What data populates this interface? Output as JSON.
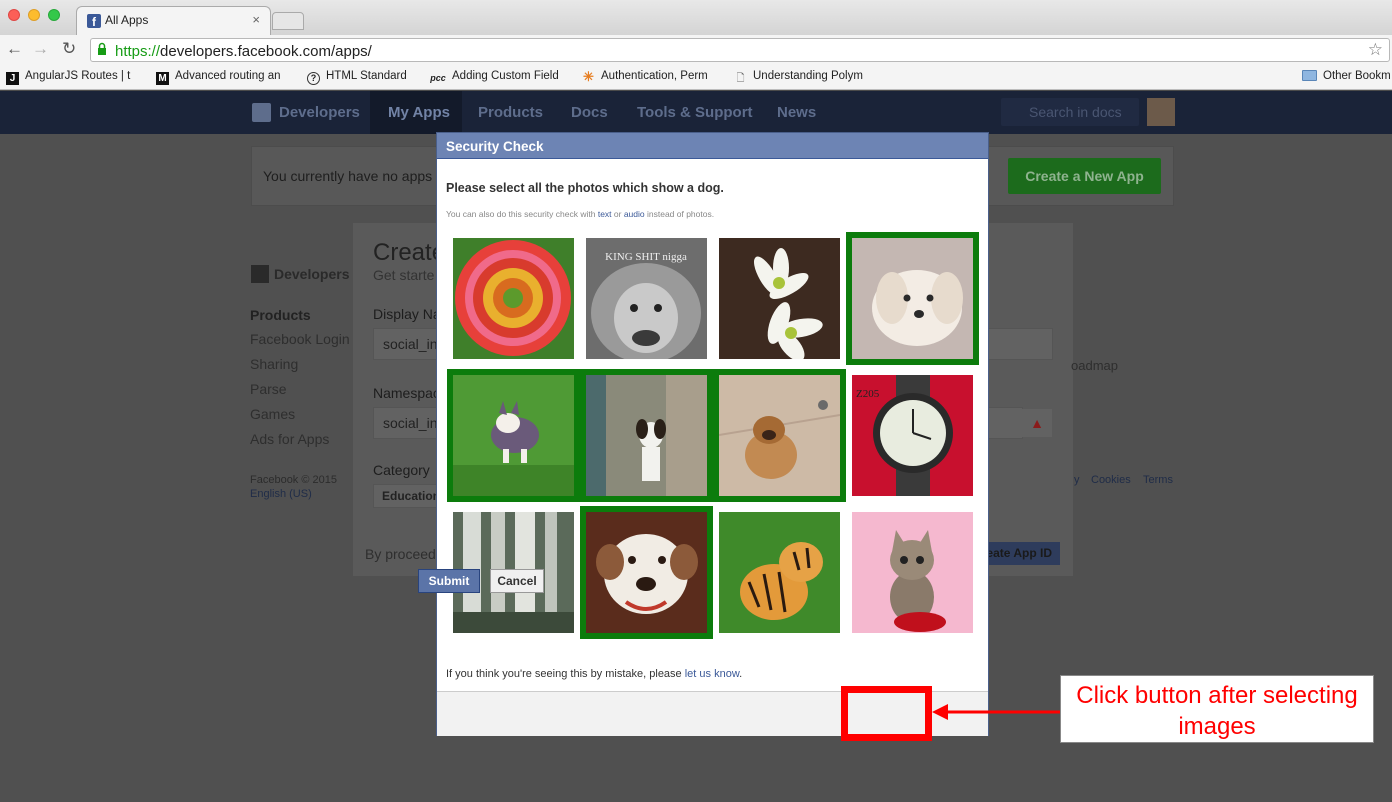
{
  "browser": {
    "tab_title": "All Apps",
    "tab_close": "×",
    "url_scheme": "https://",
    "url_rest": "developers.facebook.com/apps/",
    "bookmarks": [
      {
        "label": "AngularJS Routes | t",
        "icon": "J"
      },
      {
        "label": "Advanced routing an",
        "icon": "M"
      },
      {
        "label": "HTML Standard",
        "icon": "?"
      },
      {
        "label": "Adding Custom Field",
        "icon": "pcc"
      },
      {
        "label": "Authentication, Perm",
        "icon": "✳"
      },
      {
        "label": "Understanding Polym",
        "icon": "🗋"
      },
      {
        "label": "Other Bookm",
        "icon": "folder"
      }
    ]
  },
  "fb_nav": {
    "brand": "Developers",
    "items": [
      "My Apps",
      "Products",
      "Docs",
      "Tools & Support",
      "News"
    ],
    "search_placeholder": "Search in docs"
  },
  "background_page": {
    "no_apps_text": "You currently have no apps",
    "create_app_label": "Create a New App",
    "sidebar_brand": "Developers",
    "sidebar_heading": "Products",
    "sidebar_items": [
      "Facebook Login",
      "Sharing",
      "Parse",
      "Games",
      "Ads for Apps"
    ],
    "copyright": "Facebook © 2015",
    "language": "English (US)",
    "form_title": "Create",
    "form_subtitle": "Get starte",
    "display_name_label": "Display Na",
    "display_name_value": "social_in",
    "namespace_label": "Namespac",
    "namespace_value": "social_in",
    "category_label": "Category",
    "category_value": "Education",
    "footer_text": "By proceed",
    "create_id_label": "eate App ID",
    "right_link_roadmap": "oadmap",
    "right_link_y": "y",
    "right_link_cookies": "Cookies",
    "right_link_terms": "Terms",
    "warning_icon": "warning-icon"
  },
  "modal": {
    "title": "Security Check",
    "prompt": "Please select all the photos which show a dog.",
    "alt_prefix": "You can also do this security check with ",
    "alt_text_link": "text",
    "alt_or": " or ",
    "alt_audio_link": "audio",
    "alt_suffix": " instead of photos.",
    "mistake_prefix": "If you think you're seeing this by mistake, please ",
    "mistake_link": "let us know",
    "mistake_suffix": ".",
    "submit_label": "Submit",
    "cancel_label": "Cancel",
    "photos": [
      {
        "subject": "flower",
        "selected": false,
        "caption": ""
      },
      {
        "subject": "lion",
        "selected": false,
        "caption": "KING SHIT nigga"
      },
      {
        "subject": "flower",
        "selected": false,
        "caption": ""
      },
      {
        "subject": "dog",
        "selected": true,
        "caption": ""
      },
      {
        "subject": "dog",
        "selected": true,
        "caption": ""
      },
      {
        "subject": "dog",
        "selected": true,
        "caption": ""
      },
      {
        "subject": "dog",
        "selected": true,
        "caption": ""
      },
      {
        "subject": "watch",
        "selected": false,
        "caption": "Z205"
      },
      {
        "subject": "waterfall",
        "selected": false,
        "caption": ""
      },
      {
        "subject": "dog",
        "selected": true,
        "caption": ""
      },
      {
        "subject": "tiger",
        "selected": false,
        "caption": ""
      },
      {
        "subject": "kitten",
        "selected": false,
        "caption": ""
      }
    ]
  },
  "annotation": {
    "line1": "Click button after selecting",
    "line2": "images",
    "color": "#ff0000"
  },
  "colors": {
    "fb_blue": "#3b5998",
    "modal_header": "#6d84b4",
    "selected_border": "#0c7c0c",
    "create_button": "#1c6b1c"
  }
}
